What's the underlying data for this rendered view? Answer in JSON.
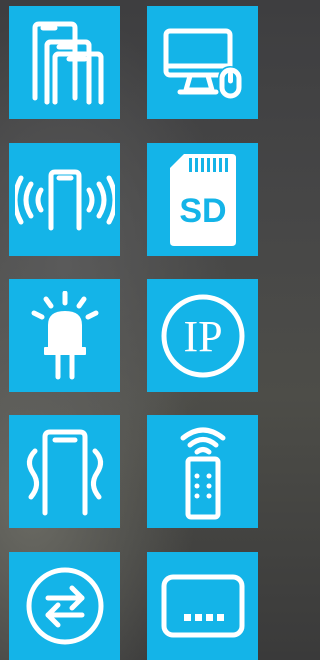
{
  "tiles": [
    {
      "id": "walk-through-gates",
      "icon": "double-walk-through-gate-icon"
    },
    {
      "id": "computer-software",
      "icon": "computer-with-mouse-icon"
    },
    {
      "id": "alarm-gate",
      "icon": "gate-with-alarm-waves-icon"
    },
    {
      "id": "sd-card",
      "icon": "sd-card-icon",
      "label": "SD"
    },
    {
      "id": "led-indicator",
      "icon": "led-light-icon"
    },
    {
      "id": "ip-rating",
      "icon": "ip-rating-icon",
      "label": "IP"
    },
    {
      "id": "vibration-gate",
      "icon": "gate-with-vibration-icon"
    },
    {
      "id": "remote-control",
      "icon": "remote-control-icon"
    },
    {
      "id": "bidirectional",
      "icon": "bidirectional-arrows-icon"
    },
    {
      "id": "lcd-display",
      "icon": "lcd-display-icon"
    }
  ],
  "colors": {
    "tile": "#14b4e8",
    "icon": "#ffffff"
  }
}
